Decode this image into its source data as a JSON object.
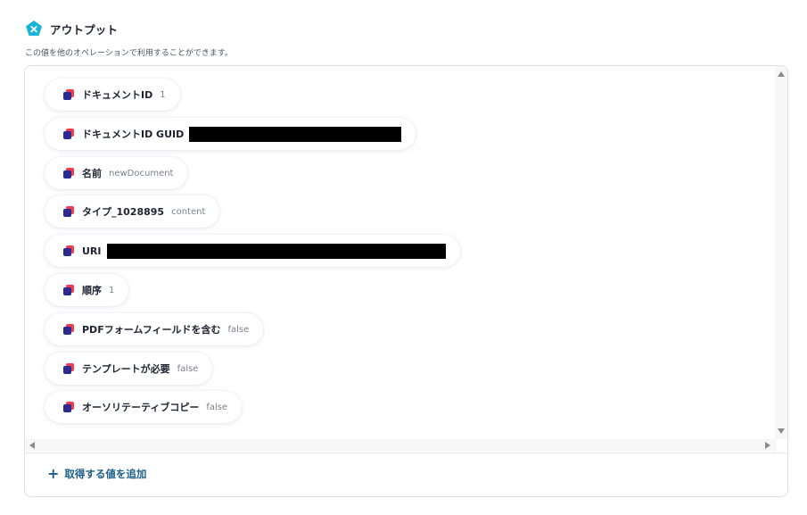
{
  "header": {
    "title": "アウトプット",
    "subtitle": "この値を他のオペレーションで利用することができます。",
    "icon": "pentagon-x-icon",
    "icon_color": "#1ab3d8"
  },
  "outputs": [
    {
      "label": "ドキュメントID",
      "value": "1",
      "redacted": false
    },
    {
      "label": "ドキュメントID GUID",
      "value": "",
      "redacted": true
    },
    {
      "label": "名前",
      "value": "newDocument",
      "redacted": false
    },
    {
      "label": "タイプ_1028895",
      "value": "content",
      "redacted": false
    },
    {
      "label": "URI",
      "value": "",
      "redacted": true
    },
    {
      "label": "順序",
      "value": "1",
      "redacted": false
    },
    {
      "label": "PDFフォームフィールドを含む",
      "value": "false",
      "redacted": false
    },
    {
      "label": "テンプレートが必要",
      "value": "false",
      "redacted": false
    },
    {
      "label": "オーソリテーティブコピー",
      "value": "false",
      "redacted": false
    }
  ],
  "footer": {
    "add_label": "取得する値を追加",
    "add_icon": "plus-icon"
  },
  "colors": {
    "accent": "#1b5e87",
    "chip_icon_red": "#ef3b4f",
    "chip_icon_navy": "#2b2a8f"
  }
}
